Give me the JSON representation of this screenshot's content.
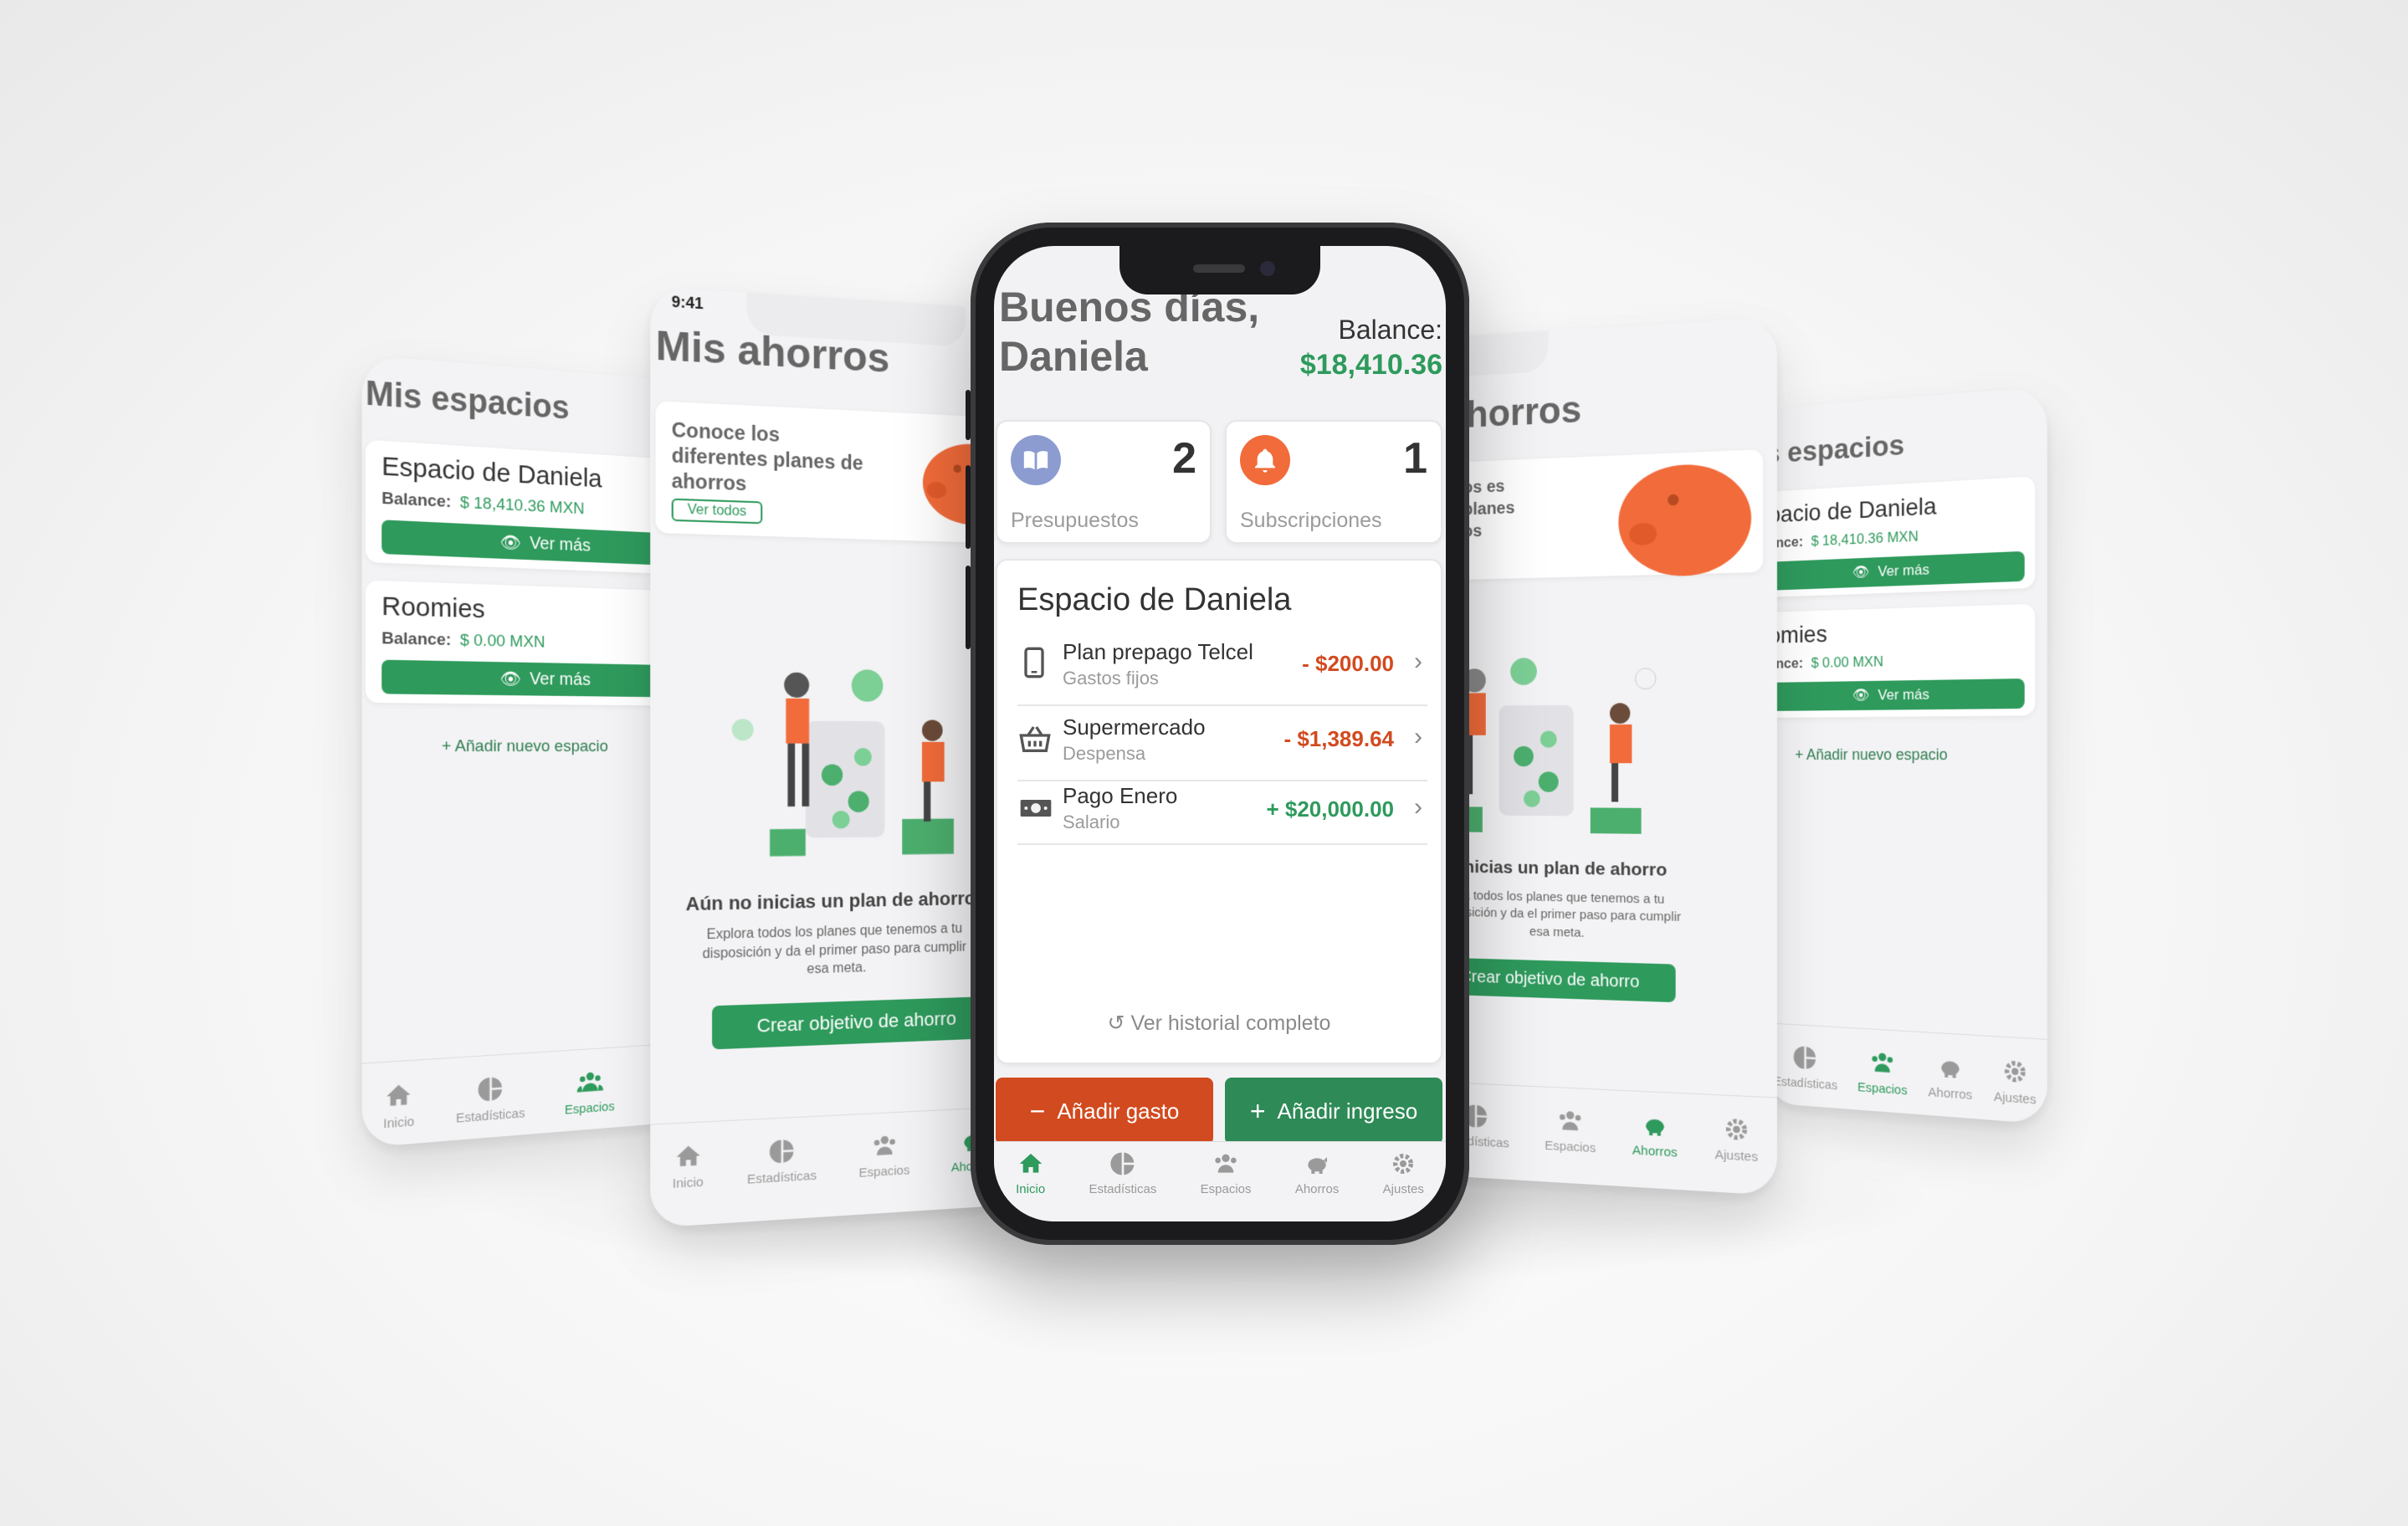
{
  "colors": {
    "brand_green": "#2e9a5c",
    "expense_red": "#d24a1f",
    "accent_orange": "#f26b3a",
    "budget_blue": "#8c9bd0"
  },
  "tabs": [
    "Inicio",
    "Estadísticas",
    "Espacios",
    "Ahorros",
    "Ajustes"
  ],
  "main": {
    "greeting_line1": "Buenos días,",
    "greeting_line2": "Daniela",
    "balance_label": "Balance:",
    "balance_value": "$18,410.36",
    "stat_budgets": {
      "count": "2",
      "label": "Presupuestos",
      "icon": "book-icon"
    },
    "stat_subscriptions": {
      "count": "1",
      "label": "Subscripciones",
      "icon": "bell-icon"
    },
    "space_title": "Espacio de Daniela",
    "transactions": [
      {
        "title": "Plan prepago Telcel",
        "category": "Gastos fijos",
        "amount": "- $200.00",
        "icon": "phone-icon",
        "type": "expense"
      },
      {
        "title": "Supermercado",
        "category": "Despensa",
        "amount": "- $1,389.64",
        "icon": "basket-icon",
        "type": "expense"
      },
      {
        "title": "Pago Enero",
        "category": "Salario",
        "amount": "+ $20,000.00",
        "icon": "cash-icon",
        "type": "income"
      }
    ],
    "history_link": "Ver historial completo",
    "add_expense": "Añadir gasto",
    "add_income": "Añadir ingreso",
    "active_tab": "Inicio"
  },
  "spaces": {
    "title": "Mis espacios",
    "items": [
      {
        "name": "Espacio de Daniela",
        "balance_label": "Balance:",
        "balance": "$ 18,410.36 MXN",
        "cta": "Ver más"
      },
      {
        "name": "Roomies",
        "balance_label": "Balance:",
        "balance": "$ 0.00 MXN",
        "cta": "Ver más"
      }
    ],
    "add_space": "Añadir nuevo espacio",
    "active_tab": "Espacios"
  },
  "savings": {
    "title": "Mis ahorros",
    "promo_text": "Conoce los diferentes planes de ahorros",
    "promo_cta": "Ver todos",
    "empty_title": "Aún no inicias un plan de ahorro",
    "empty_body": "Explora todos los planes que tenemos a tu disposición y da el primer paso para cumplir esa meta.",
    "create_cta": "Crear objetivo de ahorro",
    "active_tab": "Ahorros"
  },
  "right_savings": {
    "title_fragment": "horros",
    "promo_fragment": "os es planes os",
    "empty_title_fragment": "no inicias un plan de ahorro",
    "empty_body_fragment": "ora todos los planes que tenemos a tu disposición y da el primer paso para cumplir esa meta.",
    "create_cta": "Crear objetivo de ahorro"
  },
  "right_spaces": {
    "title_fragment": "s espacios",
    "items": [
      {
        "name_fragment": "pacio de Daniela",
        "balance_label": "ance:",
        "balance": "$ 18,410.36 MXN",
        "cta": "Ver más"
      },
      {
        "name_fragment": "omies",
        "balance_label": "ance:",
        "balance": "$ 0.00 MXN",
        "cta": "Ver más"
      }
    ],
    "add_space": "Añadir nuevo espacio"
  },
  "status_time": "9:41"
}
